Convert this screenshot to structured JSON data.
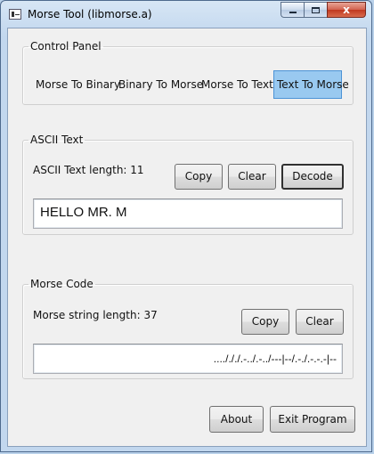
{
  "window": {
    "title": "Morse Tool (libmorse.a)",
    "close_glyph": "x"
  },
  "control_panel": {
    "legend": "Control Panel",
    "modes": [
      "Morse To Binary",
      "Binary To Morse",
      "Morse To Text",
      "Text To Morse"
    ],
    "selected_mode": "Text To Morse"
  },
  "ascii": {
    "legend": "ASCII Text",
    "length_label": "ASCII Text length: 11",
    "copy_label": "Copy",
    "clear_label": "Clear",
    "decode_label": "Decode",
    "value": "HELLO MR. M"
  },
  "morse": {
    "legend": "Morse Code",
    "length_label": "Morse string length: 37",
    "copy_label": "Copy",
    "clear_label": "Clear",
    "value": "..../././.-../.-../---|--/.-./.-.-.-|--"
  },
  "footer": {
    "about_label": "About",
    "exit_label": "Exit Program"
  },
  "colors": {
    "selected_mode_bg": "#99c9f0",
    "selected_mode_border": "#4c93d6",
    "title_bar": "#c2d7ee"
  }
}
